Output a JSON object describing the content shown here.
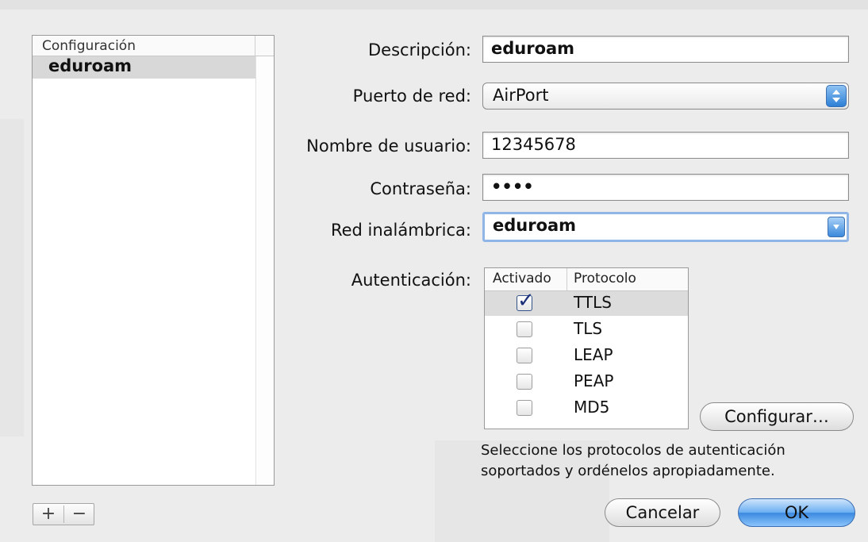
{
  "list": {
    "header": "Configuración",
    "items": [
      "eduroam"
    ]
  },
  "buttons": {
    "add": "+",
    "remove": "−",
    "configure": "Configurar…",
    "cancel": "Cancelar",
    "ok": "OK"
  },
  "form": {
    "description": {
      "label": "Descripción:",
      "value": "eduroam"
    },
    "network_port": {
      "label": "Puerto de red:",
      "value": "AirPort"
    },
    "username": {
      "label": "Nombre de usuario:",
      "value": "12345678"
    },
    "password": {
      "label": "Contraseña:",
      "value": "••••"
    },
    "wireless_network": {
      "label": "Red inalámbrica:",
      "value": "eduroam"
    },
    "authentication": {
      "label": "Autenticación:"
    }
  },
  "auth_table": {
    "headers": [
      "Activado",
      "Protocolo"
    ],
    "rows": [
      {
        "protocol": "TTLS",
        "enabled": true
      },
      {
        "protocol": "TLS",
        "enabled": false
      },
      {
        "protocol": "LEAP",
        "enabled": false
      },
      {
        "protocol": "PEAP",
        "enabled": false
      },
      {
        "protocol": "MD5",
        "enabled": false
      }
    ]
  },
  "help_text": {
    "line1": "Seleccione los protocolos de autenticación",
    "line2": "soportados y ordénelos apropiadamente."
  },
  "colors": {
    "accent": "#3b89e0",
    "selection": "#dcdcdc",
    "checkmark": "#1b2f7a"
  },
  "icons": [
    "stepper-arrows-icon",
    "chevron-down-icon",
    "checkmark-icon"
  ]
}
